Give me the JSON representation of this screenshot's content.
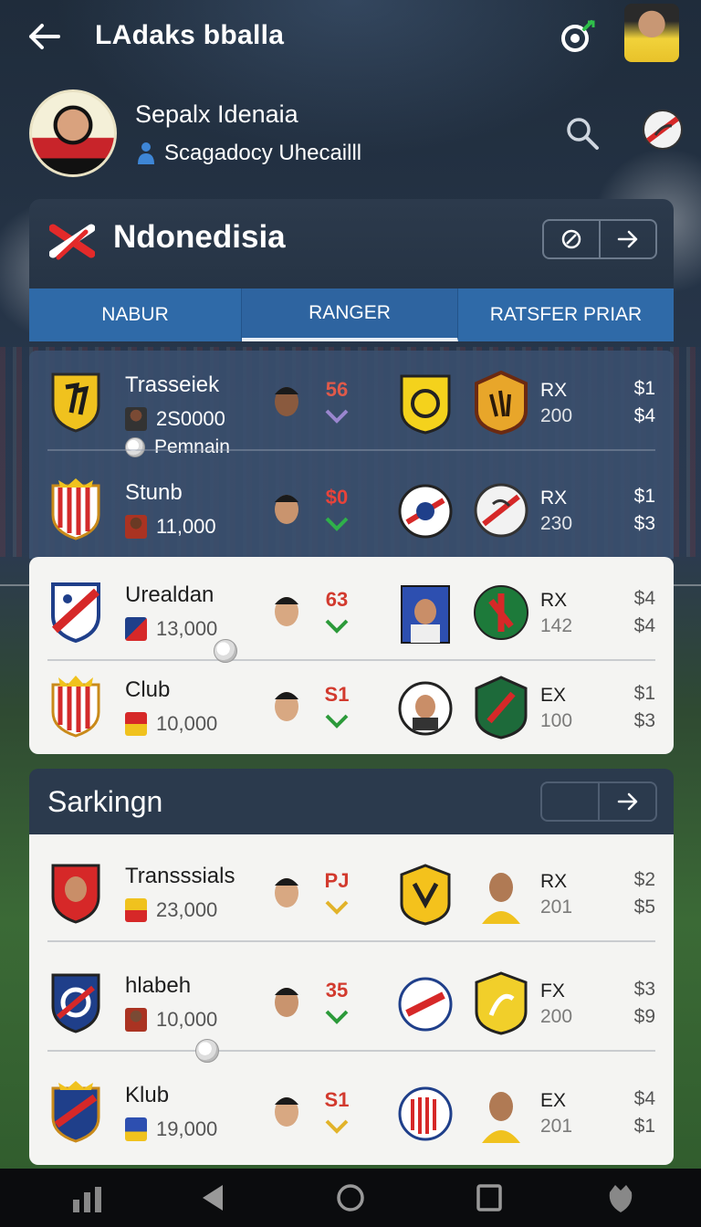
{
  "header": {
    "title": "LAdaks bballa"
  },
  "profile": {
    "name": "Sepalx Idenaia",
    "subtitle": "Scagadocy Uhecailll"
  },
  "section1": {
    "title": "Ndonedisia",
    "tabs": [
      {
        "label": "NABUR",
        "active": false
      },
      {
        "label": "RANGER",
        "active": true
      },
      {
        "label": "RATSFER PRIAR",
        "active": false
      }
    ],
    "rows": [
      {
        "club": "Trasseiek",
        "fee": "2S0000",
        "extra": "Pemnain",
        "delta": "56",
        "trend": "down",
        "code": "RX",
        "code_value": "200",
        "price_a": "$1",
        "price_b": "$4"
      },
      {
        "club": "Stunb",
        "fee": "11,000",
        "delta": "$0",
        "trend": "down",
        "code": "RX",
        "code_value": "230",
        "price_a": "$1",
        "price_b": "$3"
      },
      {
        "club": "Urealdan",
        "fee": "13,000",
        "delta": "63",
        "trend": "down",
        "code": "RX",
        "code_value": "142",
        "price_a": "$4",
        "price_b": "$4"
      },
      {
        "club": "Club",
        "fee": "10,000",
        "delta": "S1",
        "trend": "down",
        "code": "EX",
        "code_value": "100",
        "price_a": "$1",
        "price_b": "$3"
      }
    ]
  },
  "section2": {
    "title": "Sarkingn",
    "rows": [
      {
        "club": "Transssials",
        "fee": "23,000",
        "delta": "PJ",
        "trend": "down",
        "code": "RX",
        "code_value": "201",
        "price_a": "$2",
        "price_b": "$5"
      },
      {
        "club": "hlabeh",
        "fee": "10,000",
        "delta": "35",
        "trend": "down",
        "code": "FX",
        "code_value": "200",
        "price_a": "$3",
        "price_b": "$9"
      },
      {
        "club": "Klub",
        "fee": "19,000",
        "delta": "S1",
        "trend": "down",
        "code": "EX",
        "code_value": "201",
        "price_a": "$4",
        "price_b": "$1"
      }
    ]
  },
  "icons": {
    "back": "arrow-left-icon",
    "target": "target-icon",
    "search": "search-icon",
    "flag": "flag-circle-icon",
    "cancel": "slash-circle-icon",
    "forward": "arrow-right-icon",
    "nav": [
      "stats-icon",
      "back-triangle-icon",
      "home-circle-icon",
      "recents-square-icon",
      "app-icon"
    ]
  },
  "colors": {
    "tab_blue": "#2f6aa8",
    "delta_red": "#d23a2e",
    "chevron_green": "#2c9a3a",
    "chevron_yellow": "#e2b32a",
    "chevron_purple": "#9a86cf"
  }
}
